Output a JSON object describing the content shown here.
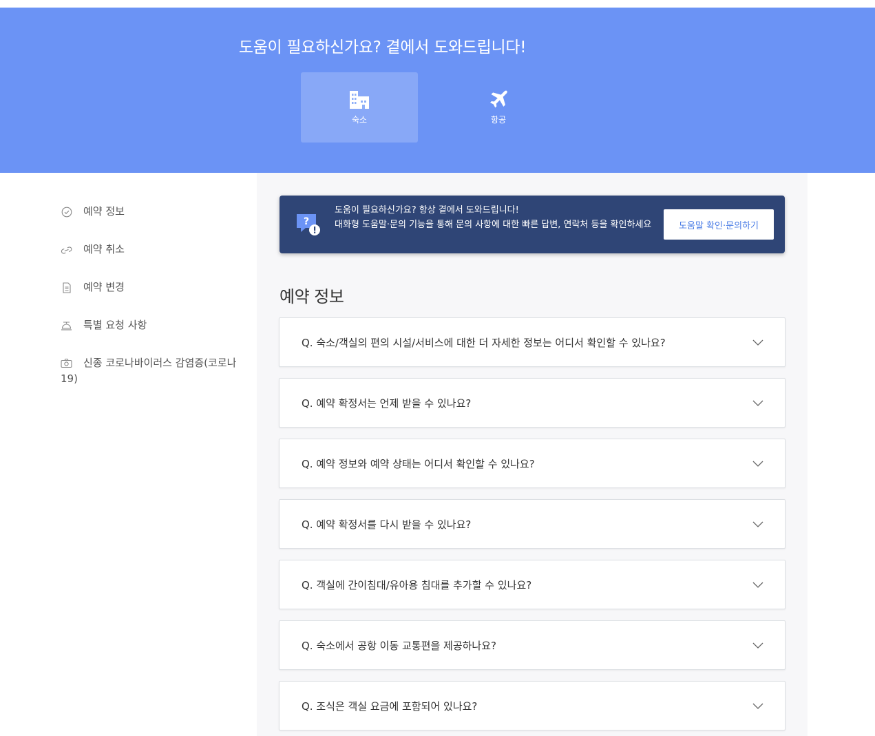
{
  "hero": {
    "title": "도움이 필요하신가요? 곁에서 도와드립니다!",
    "tabs": [
      {
        "label": "숙소",
        "icon": "hotel-icon",
        "active": true
      },
      {
        "label": "항공",
        "icon": "airplane-icon",
        "active": false
      }
    ]
  },
  "sidebar": {
    "items": [
      {
        "label": "예약 정보",
        "icon": "check-circle-icon"
      },
      {
        "label": "예약 취소",
        "icon": "link-broken-icon"
      },
      {
        "label": "예약 변경",
        "icon": "document-icon"
      },
      {
        "label": "특별 요청 사항",
        "icon": "bell-service-icon"
      },
      {
        "label": "신종 코로나바이러스 감염증(코로나 19)",
        "icon": "camera-icon"
      }
    ]
  },
  "banner": {
    "title": "도움이 필요하신가요? 항상 곁에서 도와드립니다!",
    "description": "대화형 도움말·문의 기능을 통해 문의 사항에 대한 빠른 답변, 연락처 등을 확인하세요",
    "button_label": "도움말 확인·문의하기"
  },
  "section": {
    "title": "예약 정보"
  },
  "faqs": [
    "Q. 숙소/객실의 편의 시설/서비스에 대한 더 자세한 정보는 어디서 확인할 수 있나요?",
    "Q. 예약 확정서는 언제 받을 수 있나요?",
    "Q. 예약 정보와 예약 상태는 어디서 확인할 수 있나요?",
    "Q. 예약 확정서를 다시 받을 수 있나요?",
    "Q. 객실에 간이침대/유아용 침대를 추가할 수 있나요?",
    "Q. 숙소에서 공항 이동 교통편을 제공하나요?",
    "Q. 조식은 객실 요금에 포함되어 있나요?"
  ],
  "colors": {
    "hero_bg": "#6b93f5",
    "banner_bg": "#2f4576",
    "link": "#4a7ce6"
  }
}
